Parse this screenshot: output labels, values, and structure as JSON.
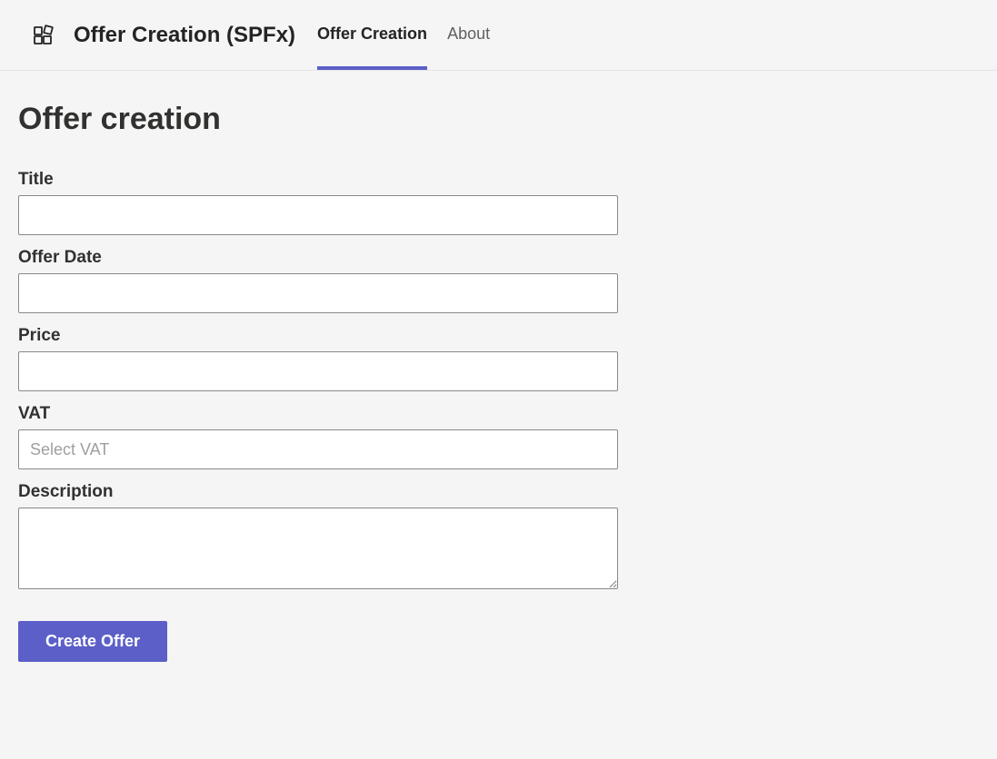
{
  "header": {
    "app_title": "Offer Creation (SPFx)",
    "tabs": [
      {
        "label": "Offer Creation",
        "active": true
      },
      {
        "label": "About",
        "active": false
      }
    ]
  },
  "main": {
    "page_title": "Offer creation",
    "form": {
      "title": {
        "label": "Title",
        "value": ""
      },
      "offer_date": {
        "label": "Offer Date",
        "value": ""
      },
      "price": {
        "label": "Price",
        "value": ""
      },
      "vat": {
        "label": "VAT",
        "placeholder": "Select VAT",
        "value": ""
      },
      "description": {
        "label": "Description",
        "value": ""
      },
      "submit_label": "Create Offer"
    }
  }
}
